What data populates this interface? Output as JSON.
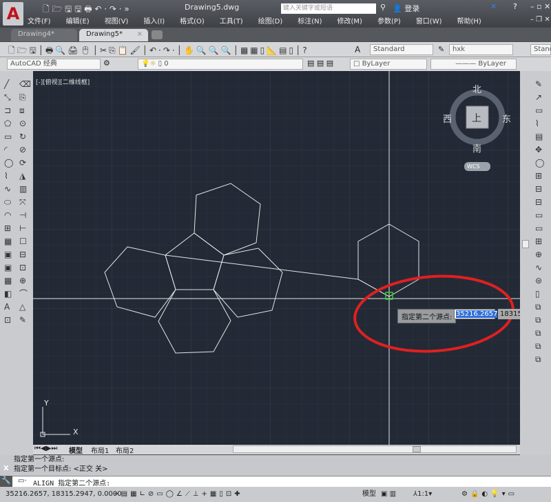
{
  "app": {
    "title": "Drawing5.dwg",
    "search_placeholder": "键入关键字或短语",
    "login": "登录"
  },
  "menu": [
    "文件(F)",
    "编辑(E)",
    "视图(V)",
    "插入(I)",
    "格式(O)",
    "工具(T)",
    "绘图(D)",
    "标注(N)",
    "修改(M)",
    "参数(P)",
    "窗口(W)",
    "帮助(H)"
  ],
  "tabs": [
    {
      "label": "Drawing4*"
    },
    {
      "label": "Drawing5*"
    }
  ],
  "toolbar": {
    "text_style": "Standard",
    "dim_style": "hxk",
    "table_style": "Stand",
    "workspace": "AutoCAD 经典",
    "layer": "0",
    "color": "ByLayer",
    "linetype": "ByLayer"
  },
  "viewport": {
    "label": "[-][俯视][二维线框]"
  },
  "viewcube": {
    "north": "北",
    "south": "南",
    "east": "东",
    "west": "西",
    "top": "上",
    "wcs": "WCS"
  },
  "ucs": {
    "x": "X",
    "y": "Y"
  },
  "tooltip": {
    "prompt": "指定第二个源点:",
    "x_value": "35216.2657",
    "y_value": "18315"
  },
  "layout_tabs": [
    "模型",
    "布局1",
    "布局2"
  ],
  "command": {
    "history": [
      "指定第一个源点:",
      "指定第一个目标点: <正交 关>"
    ],
    "current": "ALIGN 指定第二个源点:"
  },
  "status": {
    "coords": "35216.2657, 18315.2947, 0.0000",
    "model": "模型",
    "scale": "1:1"
  },
  "colors": {
    "canvas": "#232a36",
    "annotation": "#e02020",
    "geometry": "#e6e6e6"
  }
}
